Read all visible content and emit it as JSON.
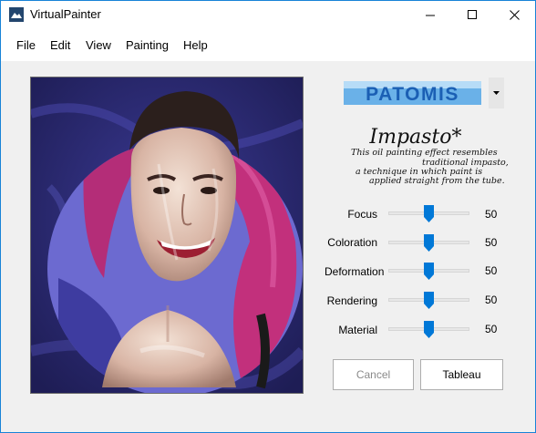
{
  "window": {
    "title": "VirtualPainter",
    "controls": [
      "minimize",
      "maximize",
      "close"
    ]
  },
  "menu": [
    "File",
    "Edit",
    "View",
    "Painting",
    "Help"
  ],
  "brand": {
    "name": "PATOMIS",
    "color": "#1b5fb4",
    "dropdown_icon": "chevron-down-icon"
  },
  "effect": {
    "title": "Impasto*",
    "description_lines": [
      "This oil painting effect resembles",
      "traditional impasto,",
      "a technique in which paint is",
      "applied straight from the tube."
    ]
  },
  "sliders": [
    {
      "label": "Focus",
      "value": 50
    },
    {
      "label": "Coloration",
      "value": 50
    },
    {
      "label": "Deformation",
      "value": 50
    },
    {
      "label": "Rendering",
      "value": 50
    },
    {
      "label": "Material",
      "value": 50
    }
  ],
  "buttons": {
    "cancel": "Cancel",
    "apply": "Tableau"
  },
  "colors": {
    "accent": "#0078d7",
    "window_border": "#1883d7",
    "painting_background": "#2c2a70",
    "painting_magenta": "#c2307c"
  }
}
